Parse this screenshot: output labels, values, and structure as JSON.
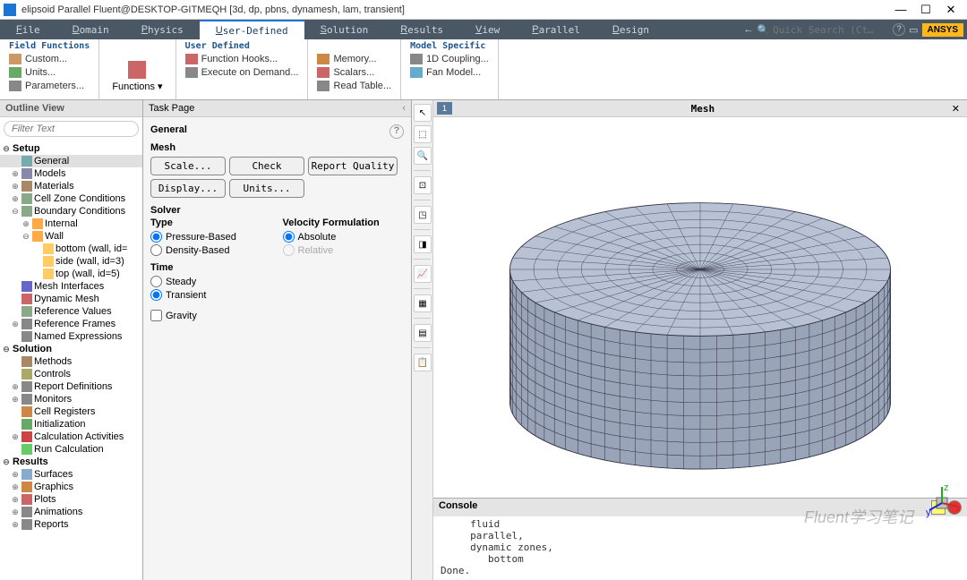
{
  "window": {
    "title": "elipsoid Parallel Fluent@DESKTOP-GITMEQH [3d, dp, pbns, dynamesh, lam, transient]",
    "min": "—",
    "max": "☐",
    "close": "✕"
  },
  "menu": {
    "items": [
      "File",
      "Domain",
      "Physics",
      "User-Defined",
      "Solution",
      "Results",
      "View",
      "Parallel",
      "Design"
    ],
    "active": 3,
    "search_placeholder": "Quick Search (Ct…",
    "brand": "ANSYS"
  },
  "ribbon": {
    "groups": [
      {
        "title": "Field Functions",
        "items": [
          "Custom...",
          "Units...",
          "Parameters..."
        ]
      },
      {
        "title": "",
        "vert": {
          "label": "Functions ▾"
        }
      },
      {
        "title": "User Defined",
        "items": [
          "Function Hooks...",
          "Execute on Demand..."
        ]
      },
      {
        "title": "",
        "items": [
          "Memory...",
          "Scalars...",
          "Read Table..."
        ]
      },
      {
        "title": "Model Specific",
        "items": [
          "1D Coupling...",
          "Fan Model..."
        ]
      }
    ]
  },
  "outline": {
    "title": "Outline View",
    "filter_placeholder": "Filter Text",
    "tree": [
      {
        "l": "Setup",
        "d": 0,
        "e": "⊖",
        "b": true
      },
      {
        "l": "General",
        "d": 1,
        "e": "",
        "sel": true,
        "i": "#7aa"
      },
      {
        "l": "Models",
        "d": 1,
        "e": "⊕",
        "i": "#88a"
      },
      {
        "l": "Materials",
        "d": 1,
        "e": "⊕",
        "i": "#a86"
      },
      {
        "l": "Cell Zone Conditions",
        "d": 1,
        "e": "⊕",
        "i": "#8a8"
      },
      {
        "l": "Boundary Conditions",
        "d": 1,
        "e": "⊖",
        "i": "#8a8"
      },
      {
        "l": "Internal",
        "d": 2,
        "e": "⊕",
        "i": "#fa4"
      },
      {
        "l": "Wall",
        "d": 2,
        "e": "⊖",
        "i": "#fa4"
      },
      {
        "l": "bottom (wall, id=",
        "d": 3,
        "e": "",
        "i": "#fc6"
      },
      {
        "l": "side (wall, id=3)",
        "d": 3,
        "e": "",
        "i": "#fc6"
      },
      {
        "l": "top (wall, id=5)",
        "d": 3,
        "e": "",
        "i": "#fc6"
      },
      {
        "l": "Mesh Interfaces",
        "d": 1,
        "e": "",
        "i": "#66c"
      },
      {
        "l": "Dynamic Mesh",
        "d": 1,
        "e": "",
        "i": "#c66"
      },
      {
        "l": "Reference Values",
        "d": 1,
        "e": "",
        "i": "#8a8"
      },
      {
        "l": "Reference Frames",
        "d": 1,
        "e": "⊕",
        "i": "#888"
      },
      {
        "l": "Named Expressions",
        "d": 1,
        "e": "",
        "i": "#888"
      },
      {
        "l": "Solution",
        "d": 0,
        "e": "⊖",
        "b": true
      },
      {
        "l": "Methods",
        "d": 1,
        "e": "",
        "i": "#a86"
      },
      {
        "l": "Controls",
        "d": 1,
        "e": "",
        "i": "#aa6"
      },
      {
        "l": "Report Definitions",
        "d": 1,
        "e": "⊕",
        "i": "#888"
      },
      {
        "l": "Monitors",
        "d": 1,
        "e": "⊕",
        "i": "#888"
      },
      {
        "l": "Cell Registers",
        "d": 1,
        "e": "",
        "i": "#c84"
      },
      {
        "l": "Initialization",
        "d": 1,
        "e": "",
        "i": "#6a6"
      },
      {
        "l": "Calculation Activities",
        "d": 1,
        "e": "⊕",
        "i": "#c44"
      },
      {
        "l": "Run Calculation",
        "d": 1,
        "e": "",
        "i": "#6c6"
      },
      {
        "l": "Results",
        "d": 0,
        "e": "⊖",
        "b": true
      },
      {
        "l": "Surfaces",
        "d": 1,
        "e": "⊕",
        "i": "#8ac"
      },
      {
        "l": "Graphics",
        "d": 1,
        "e": "⊕",
        "i": "#c84"
      },
      {
        "l": "Plots",
        "d": 1,
        "e": "⊕",
        "i": "#c66"
      },
      {
        "l": "Animations",
        "d": 1,
        "e": "⊕",
        "i": "#888"
      },
      {
        "l": "Reports",
        "d": 1,
        "e": "⊕",
        "i": "#888"
      }
    ]
  },
  "taskpage": {
    "title": "Task Page",
    "heading": "General",
    "mesh": {
      "title": "Mesh",
      "buttons": [
        "Scale...",
        "Check",
        "Report Quality",
        "Display...",
        "Units..."
      ]
    },
    "solver": {
      "title": "Solver",
      "type": {
        "h": "Type",
        "opts": [
          "Pressure-Based",
          "Density-Based"
        ],
        "sel": 0
      },
      "vel": {
        "h": "Velocity Formulation",
        "opts": [
          "Absolute",
          "Relative"
        ],
        "sel": 0,
        "dis": 1
      },
      "time": {
        "h": "Time",
        "opts": [
          "Steady",
          "Transient"
        ],
        "sel": 1
      }
    },
    "gravity": "Gravity"
  },
  "canvas": {
    "title": "Mesh",
    "tab": "1"
  },
  "console": {
    "title": "Console",
    "text": "     fluid\n     parallel,\n     dynamic zones,\n        bottom\nDone."
  },
  "watermark": "Fluent学习笔记"
}
